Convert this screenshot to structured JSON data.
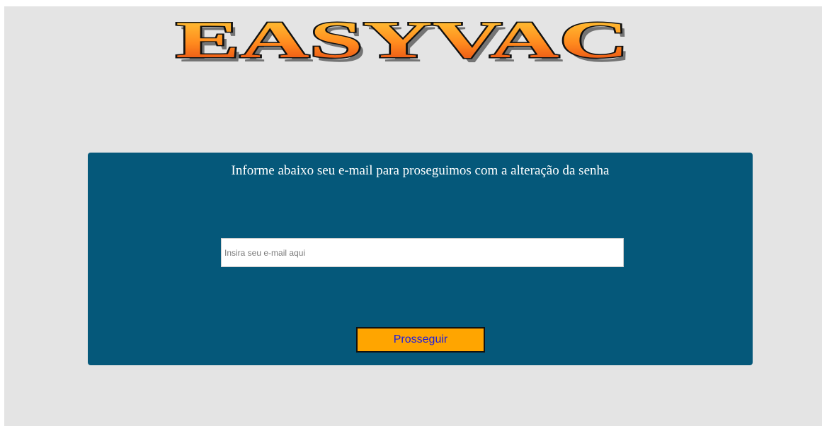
{
  "logo": {
    "text": "EASYVAC"
  },
  "colors": {
    "page_background": "#e4e4e4",
    "panel_background": "#05587a",
    "button_background": "#ffa500",
    "button_text": "#1c1ce0",
    "logo_gradient_top": "#ffd23a",
    "logo_gradient_bottom": "#e23d10"
  },
  "form": {
    "instruction": "Informe abaixo seu e-mail para proseguimos com a alteração da senha",
    "email": {
      "value": "",
      "placeholder": "Insira seu e-mail aqui"
    },
    "submit_label": "Prosseguir"
  }
}
